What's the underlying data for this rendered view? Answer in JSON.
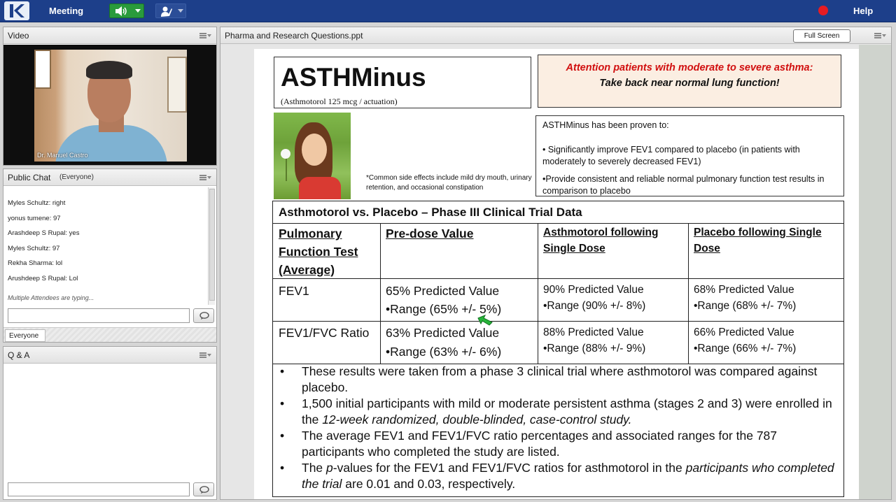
{
  "topbar": {
    "menu_meeting": "Meeting",
    "menu_help": "Help",
    "speaker_icon": "speaker-icon",
    "hand_icon": "raise-hand-icon",
    "record_color": "#e61c23"
  },
  "video": {
    "title": "Video",
    "presenter_name": "Dr. Manuel Castro"
  },
  "chat": {
    "title": "Public Chat",
    "audience": "(Everyone)",
    "messages": [
      {
        "author": "Myles Schultz",
        "text": "right"
      },
      {
        "author": "yonus tumene",
        "text": "97"
      },
      {
        "author": "Arashdeep S Rupal",
        "text": "yes"
      },
      {
        "author": "Myles Schultz",
        "text": "97"
      },
      {
        "author": "Rekha Sharma",
        "text": "lol"
      },
      {
        "author": "Arushdeep S Rupal",
        "text": "Lol"
      }
    ],
    "typing_status": "Multiple Attendees are typing...",
    "input_value": "",
    "target_tab": "Everyone"
  },
  "qa": {
    "title": "Q & A",
    "input_value": ""
  },
  "presentation": {
    "file_name": "Pharma and Research Questions.ppt",
    "fullscreen_label": "Full Screen",
    "slide": {
      "brand": "ASTHMinus",
      "dose": "(Asthmotorol 125 mcg / actuation)",
      "alert_line1": "Attention patients with moderate to severe asthma:",
      "alert_line2": "Take back near normal lung function!",
      "side_effects": "*Common side effects include mild dry mouth, urinary retention, and occasional constipation",
      "proven_heading": "ASTHMinus has been proven to:",
      "proven_item1": "• Significantly improve FEV1 compared to placebo (in patients with moderately to severely decreased FEV1)",
      "proven_item2": "•Provide consistent and reliable normal pulmonary function test results in comparison to placebo",
      "trial_title": "Asthmotorol vs. Placebo – Phase III Clinical Trial Data",
      "table": {
        "headers": [
          "Pulmonary Function Test (Average)",
          "Pre-dose Value",
          "Asthmotorol following Single Dose",
          "Placebo following Single Dose"
        ],
        "rows": [
          {
            "test": "FEV1",
            "pre": "65% Predicted Value",
            "pre_range": "•Range (65% +/- 5%)",
            "drug": "90% Predicted Value",
            "drug_range": "•Range (90% +/- 8%)",
            "placebo": "68% Predicted Value",
            "placebo_range": "•Range (68% +/- 7%)"
          },
          {
            "test": "FEV1/FVC Ratio",
            "pre": "63% Predicted Value",
            "pre_range": "•Range (63% +/- 6%)",
            "drug": "88% Predicted Value",
            "drug_range": "•Range (88% +/- 9%)",
            "placebo": "66% Predicted Value",
            "placebo_range": "•Range (66% +/- 7%)"
          }
        ]
      },
      "notes": {
        "b1": "These results were taken from a phase 3 clinical trial where asthmotorol was compared against placebo.",
        "b2_start": "1,500 initial participants with mild or moderate persistent asthma (stages 2 and 3) were enrolled in the ",
        "b2_em": "12-week randomized, double-blinded, case-control study.",
        "b3": "The average FEV1 and FEV1/FVC ratio percentages and associated ranges for the 787 participants who completed the study are listed.",
        "b4_start": "The ",
        "b4_em1": "p",
        "b4_mid": "-values for the FEV1 and FEV1/FVC ratios for asthmotorol in the ",
        "b4_em2": "participants who completed the trial",
        "b4_end": " are 0.01 and 0.03, respectively."
      }
    }
  }
}
